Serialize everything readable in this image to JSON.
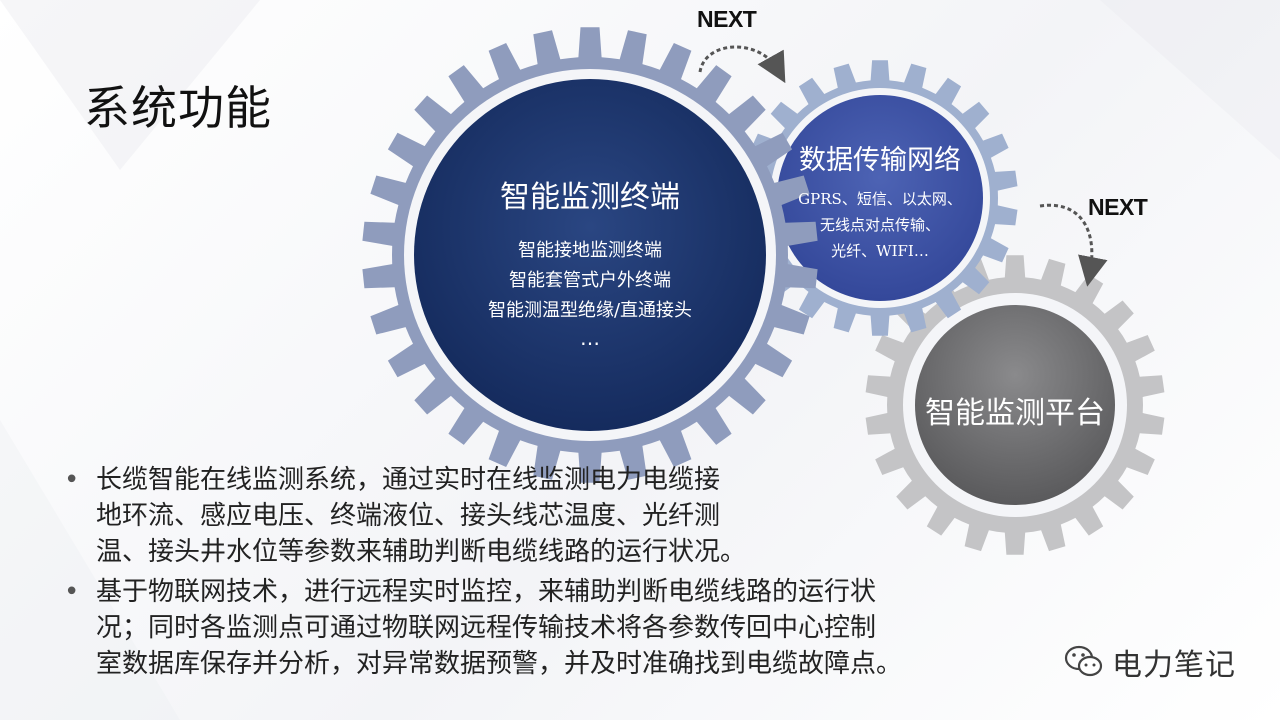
{
  "title": "系统功能",
  "gear1": {
    "title": "智能监测终端",
    "items": [
      "智能接地监测终端",
      "智能套管式户外终端",
      "智能测温型绝缘/直通接头"
    ],
    "more": "…"
  },
  "gear2": {
    "title": "数据传输网络",
    "items": [
      "GPRS、短信、以太网、",
      "无线点对点传输、",
      "光纤、WIFI…"
    ]
  },
  "gear3": {
    "title": "智能监测平台"
  },
  "next_labels": [
    "NEXT",
    "NEXT"
  ],
  "bullets": [
    [
      "长缆智能在线监测系统，通过实时在线监测电力电缆接",
      "地环流、感应电压、终端液位、接头线芯温度、光纤测",
      "温、接头井水位等参数来辅助判断电缆线路的运行状况。"
    ],
    [
      "基于物联网技术，进行远程实时监控，来辅助判断电缆线路的运行状",
      "况；同时各监测点可通过物联网远程传输技术将各参数传回中心控制",
      "室数据库保存并分析，对异常数据预警，并及时准确找到电缆故障点。"
    ]
  ],
  "watermark": {
    "text": "电力笔记",
    "icon": "wechat-icon"
  },
  "colors": {
    "gear1_ring": "#8f9cbd",
    "gear1_core": "#1f3566",
    "gear2_ring": "#9fb0cf",
    "gear2_core": "#3a4fa0",
    "gear3_ring": "#c4c4c6",
    "gear3_core": "#6d6d6f"
  }
}
